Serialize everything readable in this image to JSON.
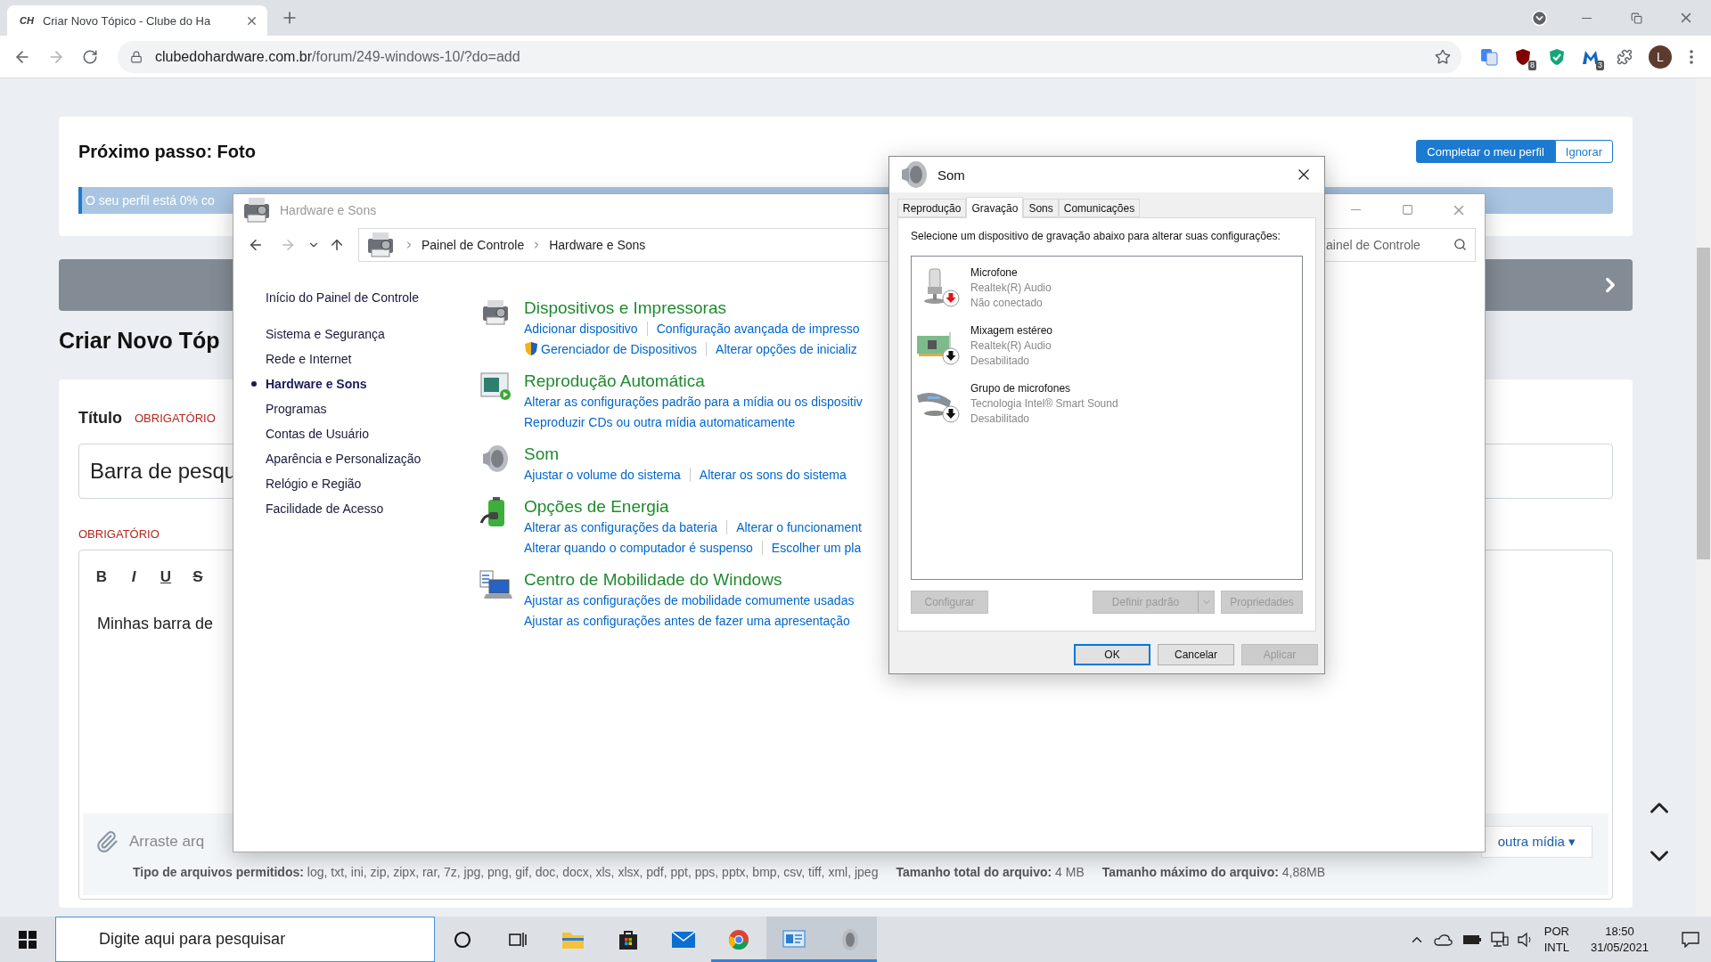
{
  "browser": {
    "tab": {
      "logo": "CH",
      "title": "Criar Novo Tópico - Clube do Ha",
      "selected": true
    },
    "url": {
      "domain": "clubedohardware.com.br",
      "path": "/forum/249-windows-10/?do=add"
    },
    "extensions": [
      {
        "kind": "translate"
      },
      {
        "kind": "ublock",
        "badge": "8"
      },
      {
        "kind": "shield"
      },
      {
        "kind": "malwarebytes",
        "badge": "3"
      },
      {
        "kind": "puzzle"
      }
    ],
    "avatar": "L"
  },
  "page": {
    "profile_card": {
      "title": "Próximo passo: Foto",
      "progress_text": "O seu perfil está 0% co",
      "level": 0,
      "buttons": [
        {
          "label": "Completar o meu perfil",
          "primary": true
        },
        {
          "label": "Ignorar",
          "primary": false
        }
      ]
    },
    "heading": "Criar Novo Tóp",
    "form": {
      "title_label": "Título",
      "title_required": "OBRIGATÓRIO",
      "title_value": "Barra de pesqu",
      "content_required": "OBRIGATÓRIO",
      "toolbar": [
        {
          "label": "B",
          "kind": "bold"
        },
        {
          "label": "I",
          "kind": "italic"
        },
        {
          "label": "U",
          "kind": "underline"
        },
        {
          "label": "S",
          "kind": "strike"
        }
      ],
      "content": "Minhas barra de",
      "attach_text": "Arraste arq",
      "media_button": "outra mídia ▾",
      "file_info": [
        "**Tipo de arquivos permitidos:** log, txt, ini, zip, zipx, rar, 7z, jpg, png, gif, doc, docx, xls, xlsx, pdf, ppt, pps, pptx, bmp, csv, tiff, xml, jpeg",
        "**Tamanho total do arquivo:** 4 MB",
        "**Tamanho máximo do arquivo:** 4,88MB"
      ]
    }
  },
  "control_panel": {
    "title": "Hardware e Sons",
    "breadcrumb": [
      "Painel de Controle",
      "Hardware e Sons"
    ],
    "search_placeholder": "ainel de Controle",
    "home": "Início do Painel de Controle",
    "nav": [
      {
        "label": "Sistema e Segurança",
        "selected": false
      },
      {
        "label": "Rede e Internet",
        "selected": false
      },
      {
        "label": "Hardware e Sons",
        "selected": true
      },
      {
        "label": "Programas",
        "selected": false
      },
      {
        "label": "Contas de Usuário",
        "selected": false
      },
      {
        "label": "Aparência e Personalização",
        "selected": false
      },
      {
        "label": "Relógio e Região",
        "selected": false
      },
      {
        "label": "Facilidade de Acesso",
        "selected": false
      }
    ],
    "categories": [
      {
        "kind": "printer",
        "title": "Dispositivos e Impressoras",
        "links": [
          [
            {
              "text": "Adicionar dispositivo",
              "shield": false
            },
            {
              "text": "Configuração avançada de impresso",
              "shield": false
            }
          ],
          [
            {
              "text": "Gerenciador de Dispositivos",
              "shield": true
            },
            {
              "text": "Alterar opções de inicializ",
              "shield": false
            }
          ]
        ]
      },
      {
        "kind": "autoplay",
        "title": "Reprodução Automática",
        "links": [
          [
            {
              "text": "Alterar as configurações padrão para a mídia ou os dispositiv",
              "shield": false
            }
          ],
          [
            {
              "text": "Reproduzir CDs ou outra mídia automaticamente",
              "shield": false
            }
          ]
        ]
      },
      {
        "kind": "speaker",
        "title": "Som",
        "links": [
          [
            {
              "text": "Ajustar o volume do sistema",
              "shield": false
            },
            {
              "text": "Alterar os sons do sistema",
              "shield": false
            }
          ]
        ]
      },
      {
        "kind": "battery",
        "title": "Opções de Energia",
        "links": [
          [
            {
              "text": "Alterar as configurações da bateria",
              "shield": false
            },
            {
              "text": "Alterar o funcionament",
              "shield": false
            }
          ],
          [
            {
              "text": "Alterar quando o computador é suspenso",
              "shield": false
            },
            {
              "text": "Escolher um pla",
              "shield": false
            }
          ]
        ]
      },
      {
        "kind": "laptop",
        "title": "Centro de Mobilidade do Windows",
        "links": [
          [
            {
              "text": "Ajustar as configurações de mobilidade comumente usadas",
              "shield": false
            }
          ],
          [
            {
              "text": "Ajustar as configurações antes de fazer uma apresentação",
              "shield": false
            }
          ]
        ]
      }
    ]
  },
  "sound_dialog": {
    "title": "Som",
    "tabs": [
      {
        "label": "Reprodução",
        "selected": false
      },
      {
        "label": "Gravação",
        "selected": true
      },
      {
        "label": "Sons",
        "selected": false
      },
      {
        "label": "Comunicações",
        "selected": false
      }
    ],
    "instruction": "Selecione um dispositivo de gravação abaixo para alterar suas configurações:",
    "devices": [
      {
        "kind": "microphone",
        "name": "Microfone",
        "driver": "Realtek(R) Audio",
        "status": "Não conectado",
        "color": "#e0141b"
      },
      {
        "kind": "card",
        "name": "Mixagem estéreo",
        "driver": "Realtek(R) Audio",
        "status": "Desabilitado",
        "color": "#111111"
      },
      {
        "kind": "array",
        "name": "Grupo de microfones",
        "driver": "Tecnologia Intel® Smart Sound",
        "status": "Desabilitado",
        "color": "#111111"
      }
    ],
    "buttons": [
      {
        "label": "Configurar",
        "kind": "plain",
        "disabled": true
      },
      {
        "label": "Definir padrão",
        "kind": "split",
        "disabled": true
      },
      {
        "label": "Propriedades",
        "kind": "plain",
        "disabled": true
      }
    ],
    "footer": [
      {
        "label": "OK",
        "default": true,
        "disabled": false
      },
      {
        "label": "Cancelar",
        "default": false,
        "disabled": false
      },
      {
        "label": "Aplicar",
        "default": false,
        "disabled": true
      }
    ]
  },
  "taskbar": {
    "search_placeholder": "Digite aqui para pesquisar",
    "apps": [
      {
        "kind": "explorer",
        "open": false,
        "active": false
      },
      {
        "kind": "store",
        "open": false,
        "active": false
      },
      {
        "kind": "mail",
        "open": false,
        "active": false
      },
      {
        "kind": "chrome",
        "open": true,
        "active": false
      },
      {
        "kind": "controlpanel",
        "open": true,
        "active": true
      },
      {
        "kind": "sound",
        "open": true,
        "active": true
      }
    ],
    "language": "POR",
    "layout": "INTL",
    "time": "18:50",
    "date": "31/05/2021"
  }
}
